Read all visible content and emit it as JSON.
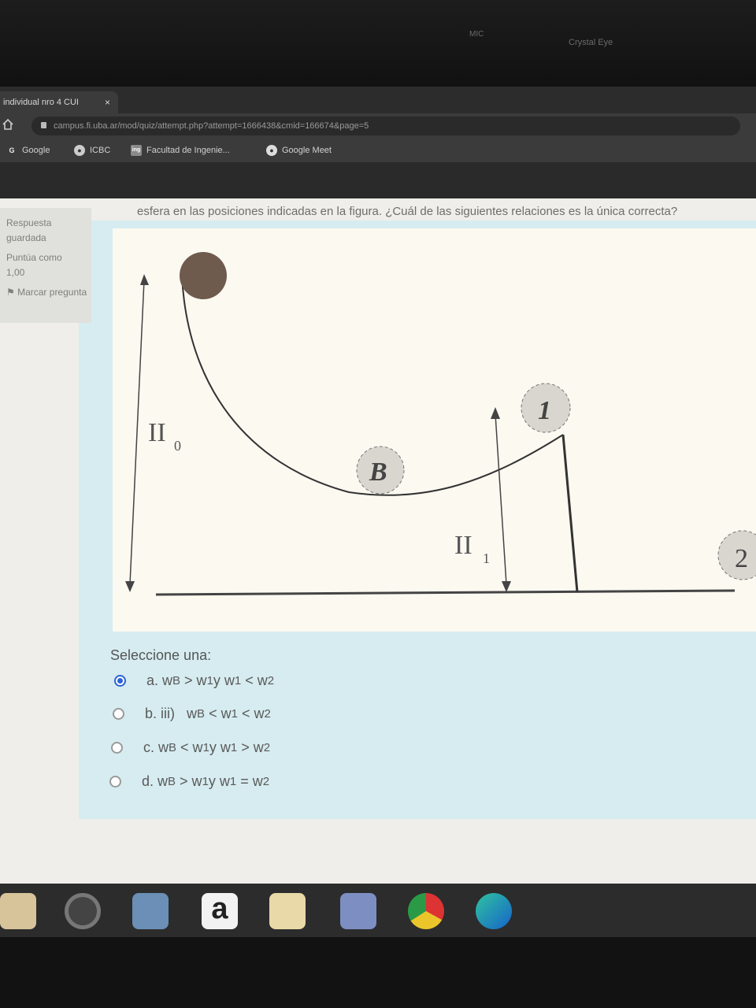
{
  "bezel": {
    "brand": "Crystal Eye",
    "small": "MIC"
  },
  "browser": {
    "tab_title": "individual nro 4 CUI",
    "tab_close": "×",
    "url": "campus.fi.uba.ar/mod/quiz/attempt.php?attempt=1666438&cmid=166674&page=5",
    "bookmarks": [
      {
        "label": "Google",
        "icon": "G"
      },
      {
        "label": "ICBC",
        "icon": "●"
      },
      {
        "label": "Facultad de Ingenie...",
        "icon": "ing"
      },
      {
        "label": "Google Meet",
        "icon": "●"
      }
    ]
  },
  "quiz_info": {
    "status": "Respuesta guardada",
    "score": "Puntúa como 1,00",
    "flag": "Marcar pregunta"
  },
  "question": {
    "text": "esfera en las posiciones indicadas en la figura. ¿Cuál de las siguientes relaciones es la única correcta?"
  },
  "figure": {
    "labels": {
      "h0": "II",
      "h0_sub": "0",
      "h1": "II",
      "h1_sub": "1",
      "ball_b": "B",
      "ball_1": "1",
      "ball_2": "2"
    }
  },
  "answers": {
    "prompt": "Seleccione una:",
    "options": [
      {
        "letter": "a.",
        "text": "w",
        "parts": [
          "B",
          "> w",
          "1",
          " y w",
          "1",
          "< w",
          "2"
        ],
        "selected": true
      },
      {
        "letter": "b. iii)",
        "parts": [
          "B",
          "< w",
          "1",
          "< w",
          "2"
        ],
        "selected": false
      },
      {
        "letter": "c.",
        "parts": [
          "B",
          "< w",
          "1",
          " y w",
          "1",
          "> w",
          "2"
        ],
        "selected": false
      },
      {
        "letter": "d.",
        "parts": [
          "B",
          "> w",
          "1",
          " y w",
          "1",
          "= w",
          "2"
        ],
        "selected": false
      }
    ]
  },
  "taskbar": {
    "icons": [
      "settings-icon",
      "speaker-icon",
      "doc-icon",
      "amazon-icon",
      "mail-icon",
      "media-icon",
      "chrome-icon",
      "edge-icon"
    ]
  },
  "colors": {
    "radio_selected": "#2c63d8",
    "panel": "#d6ecf0",
    "figure_bg": "#fbf9f0"
  }
}
